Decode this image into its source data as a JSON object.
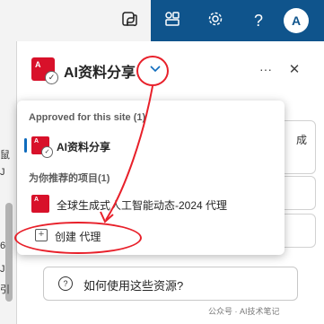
{
  "topbar": {
    "icons": [
      "copilot-icon",
      "apps-icon",
      "gear-icon",
      "help-icon"
    ],
    "help_label": "?",
    "avatar_initial": "A",
    "color": "#0f548c"
  },
  "background": {
    "left_chars": [
      "鼠",
      "J",
      "6",
      "J",
      "引"
    ],
    "right_char": "成",
    "suggestion_label": "如何使用这些资源?"
  },
  "header": {
    "agent_name": "AI资料分享",
    "more_label": "···",
    "close_label": "✕"
  },
  "dropdown": {
    "approved_title": "Approved for this site (1)",
    "approved_item": "AI资料分享",
    "recommended_title": "为你推荐的项目(1)",
    "recommended_item": "全球生成式人工智能动态-2024 代理",
    "create_label": "创建 代理"
  },
  "watermark": "公众号 · AI技术笔记",
  "colors": {
    "accent": "#0f6cbd",
    "brand_red": "#d8112a",
    "annotation_red": "#e8202a"
  }
}
